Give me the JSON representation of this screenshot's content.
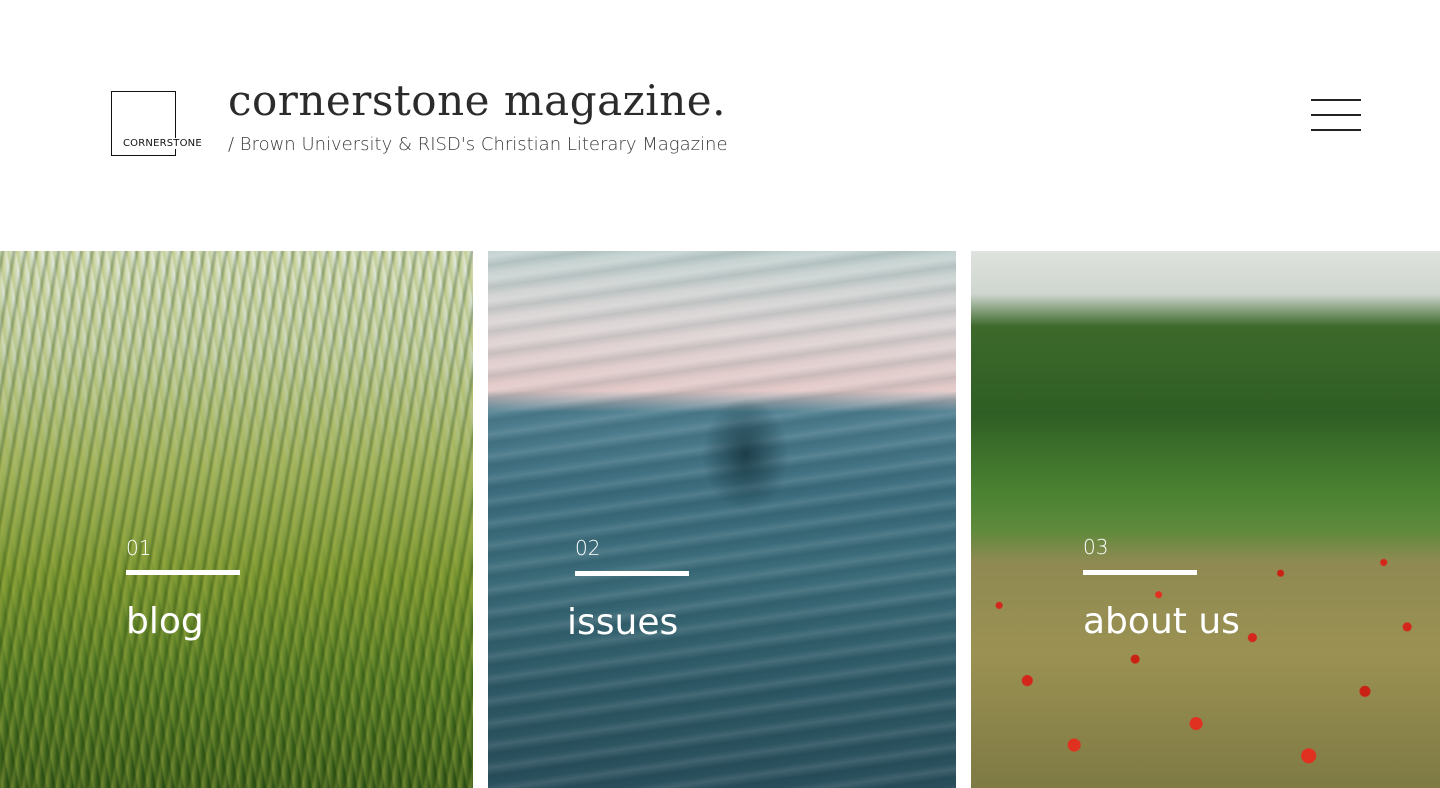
{
  "header": {
    "logo_text": "CORNERSTONE",
    "title": "cornerstone magazine.",
    "subtitle": "/ Brown University & RISD's Christian Literary Magazine",
    "menu_icon": "hamburger-menu-icon"
  },
  "panels": [
    {
      "number": "01",
      "label": "blog",
      "image": "grass"
    },
    {
      "number": "02",
      "label": "issues",
      "image": "sea"
    },
    {
      "number": "03",
      "label": "about us",
      "image": "poppy-field"
    }
  ],
  "colors": {
    "text_dark": "#2b2b2b",
    "overlay_text": "#ffffff"
  }
}
